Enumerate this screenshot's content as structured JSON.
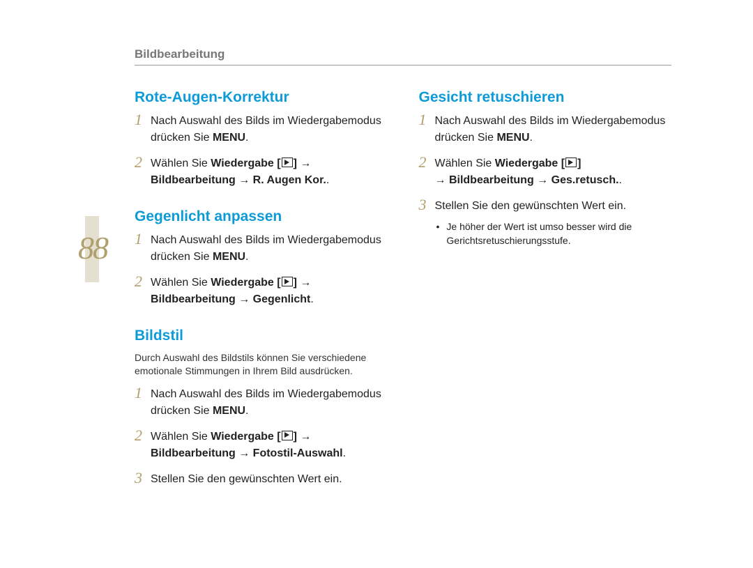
{
  "header": {
    "title": "Bildbearbeitung"
  },
  "page_number": "88",
  "text": {
    "arrow": "→",
    "select_pre": "Wählen Sie ",
    "playback": "Wiedergabe",
    "nach_auswahl_pre": "Nach Auswahl des Bilds im Wiedergabemodus drücken Sie ",
    "menu": "MENU",
    "period": "."
  },
  "sections": {
    "rote_augen": {
      "title": "Rote-Augen-Korrektur",
      "step2_tail": "Bildbearbeitung → R. Augen Kor."
    },
    "gegenlicht": {
      "title": "Gegenlicht anpassen",
      "step2_tail": "Bildbearbeitung → Gegenlicht"
    },
    "bildstil": {
      "title": "Bildstil",
      "intro": "Durch Auswahl des Bildstils können Sie verschiedene emotionale Stimmungen in Ihrem Bild ausdrücken.",
      "step2_tail": "Bildbearbeitung → Fotostil-Auswahl",
      "step3": "Stellen Sie den gewünschten Wert ein."
    },
    "gesicht": {
      "title": "Gesicht retuschieren",
      "step2_tail": "→ Bildbearbeitung → Ges.retusch.",
      "step3": "Stellen Sie den gewünschten Wert ein.",
      "bullet": "Je höher der Wert ist umso besser wird die Gerichtsretuschierungsstufe."
    }
  },
  "nums": {
    "n1": "1",
    "n2": "2",
    "n3": "3"
  }
}
